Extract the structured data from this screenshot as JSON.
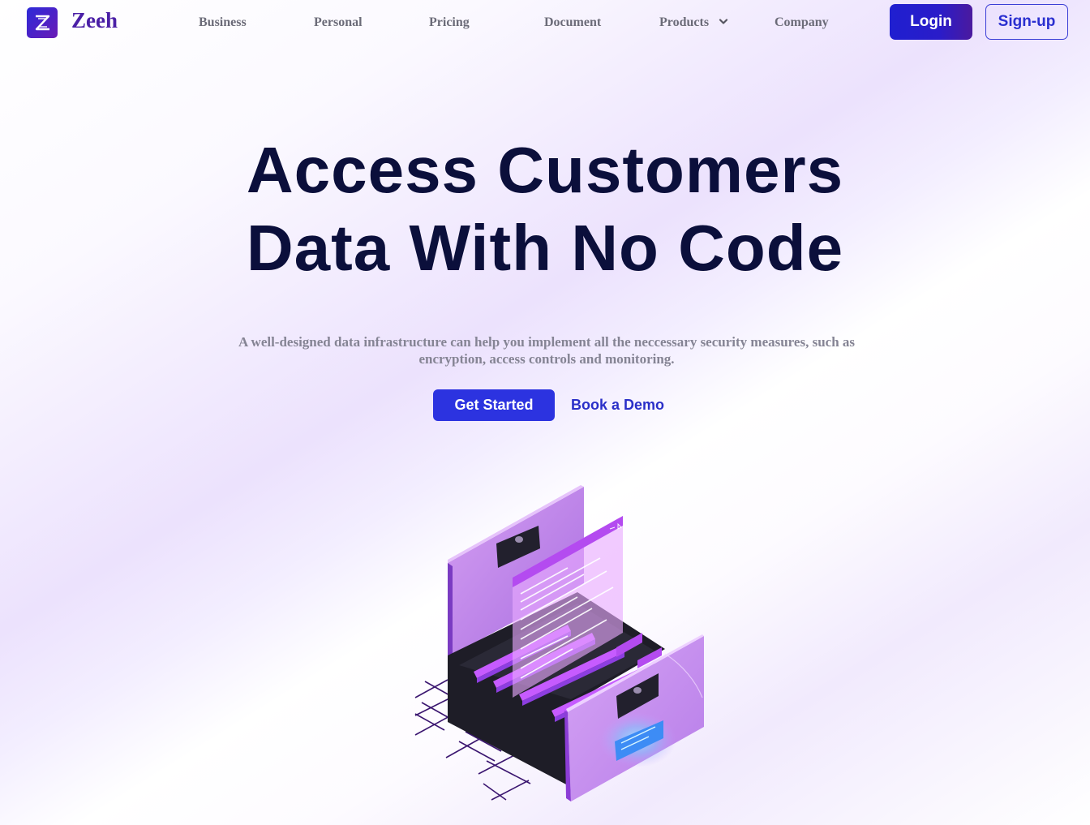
{
  "brand": {
    "name": "Zeeh",
    "logo_icon": "z-logo-icon"
  },
  "nav": {
    "items": [
      {
        "label": "Business"
      },
      {
        "label": "Personal"
      },
      {
        "label": "Pricing"
      },
      {
        "label": "Document"
      },
      {
        "label": "Products",
        "icon": "chevron-down-icon"
      },
      {
        "label": "Company"
      }
    ],
    "login_label": "Login",
    "signup_label": "Sign-up"
  },
  "hero": {
    "title_line1": "Access Customers",
    "title_line2": "Data With No Code",
    "subtitle": "A well-designed data infrastructure can help you implement all the neccessary security measures, such as encryption, access controls and monitoring.",
    "primary_cta": "Get Started",
    "secondary_cta": "Book a Demo",
    "illustration": "file-cabinet-illustration"
  },
  "colors": {
    "brand_primary": "#2c33e0",
    "brand_purple": "#4a1fa6",
    "heading": "#0b0f3b",
    "muted_text": "#858494"
  }
}
